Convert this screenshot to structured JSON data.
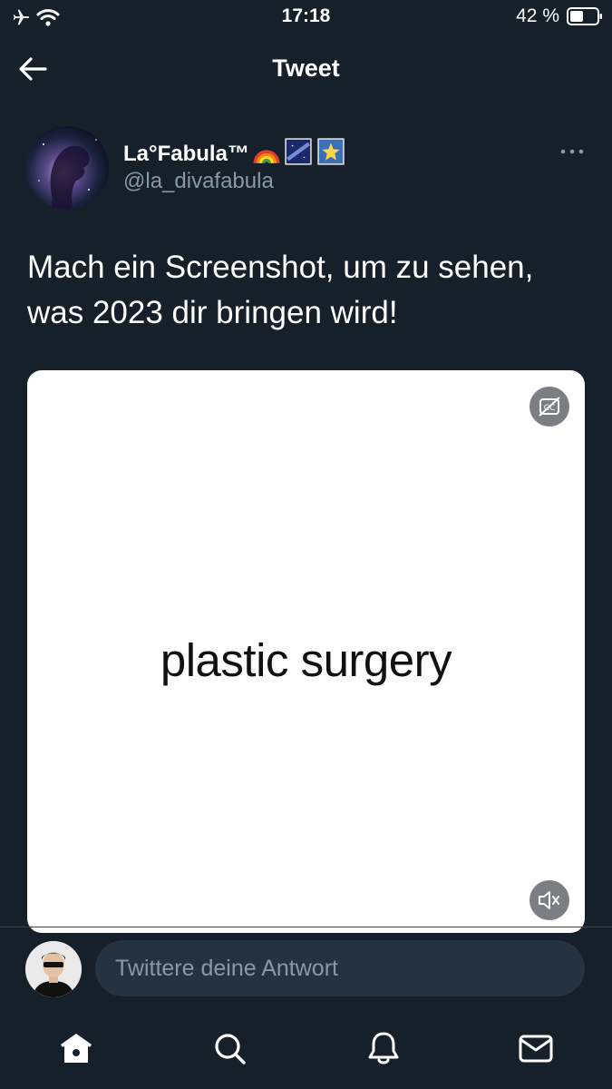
{
  "status_bar": {
    "time": "17:18",
    "battery_percent": "42 %"
  },
  "header": {
    "title": "Tweet"
  },
  "tweet": {
    "author_name": "La°Fabula™",
    "author_emojis": [
      "rainbow-emoji",
      "milky-way-emoji",
      "glowing-star-emoji"
    ],
    "author_handle": "@la_divafabula",
    "text_line1": "Mach ein Screenshot, um zu sehen,",
    "text_line2": "was 2023 dir bringen wird!",
    "media_caption": "plastic surgery"
  },
  "reply": {
    "placeholder": "Twittere deine Antwort"
  },
  "tabs": [
    "home-icon",
    "search-icon",
    "notifications-icon",
    "messages-icon"
  ],
  "colors": {
    "background": "#15202b",
    "secondary_text": "#8899a6",
    "input_bg": "#253341"
  }
}
